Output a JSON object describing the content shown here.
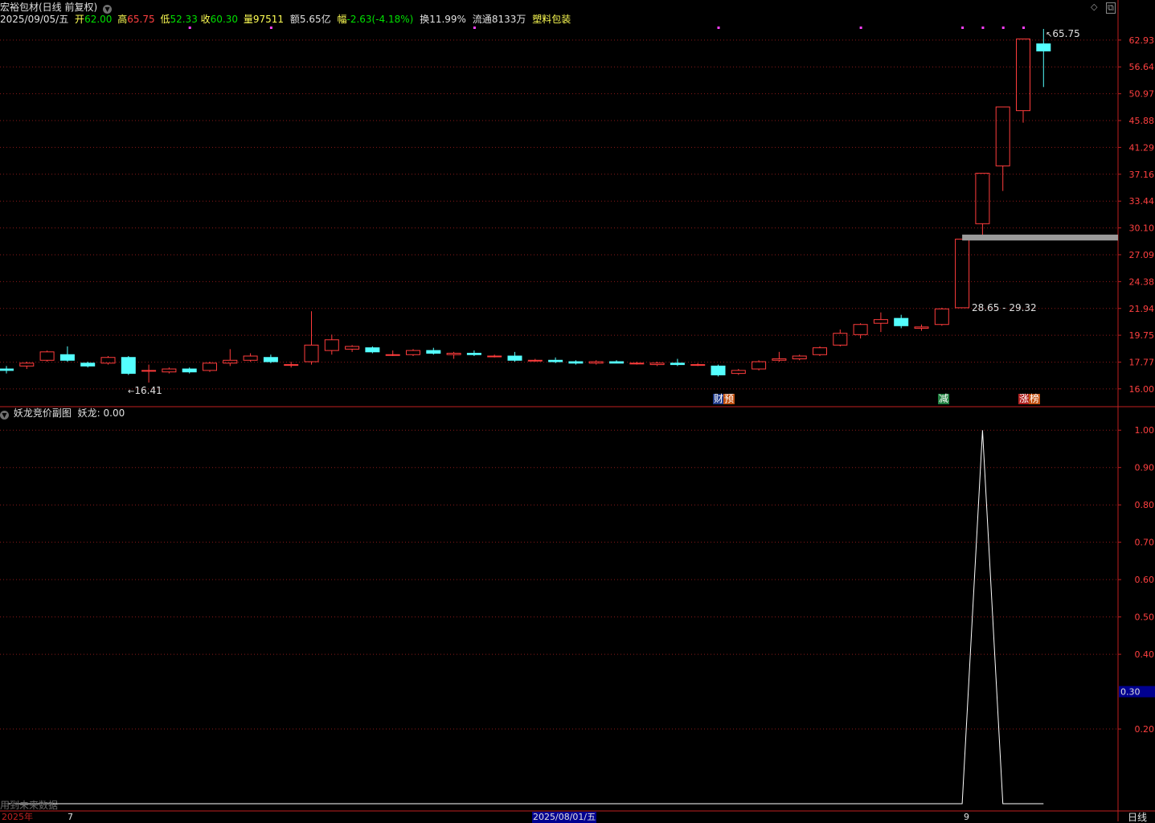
{
  "header": {
    "title": "宏裕包材(日线 前复权)",
    "row2": {
      "date": "2025/09/05/五",
      "open_label": "开",
      "open": "62.00",
      "high_label": "高",
      "high": "65.75",
      "low_label": "低",
      "low": "52.33",
      "close_label": "收",
      "close": "60.30",
      "vol_label": "量",
      "vol": "97511",
      "amt_label": "额",
      "amt": "5.65亿",
      "chg_label": "幅",
      "chg": "-2.63(-4.18%)",
      "turn_label": "换",
      "turn": "11.99%",
      "float_label": "流通",
      "float": "8133万",
      "sector": "塑料包装"
    },
    "controls": {
      "diamond": "◇",
      "restore": "⧉"
    }
  },
  "indicator": {
    "title": "妖龙竞价副图",
    "value_label": "妖龙: 0.00",
    "footnote": "用到未来数据"
  },
  "time_axis": {
    "year": "2025年",
    "m1": "7",
    "mid": "2025/08/01/五",
    "m2": "9",
    "period": "日线"
  },
  "annotations": {
    "high_label": "65.75",
    "low_label": "16.41",
    "gap_label": "28.65 - 29.32",
    "events": [
      "财",
      "预",
      "减",
      "涨",
      "榜"
    ]
  },
  "chart_data": [
    {
      "type": "candlestick",
      "ylim": [
        15.3,
        67.0
      ],
      "log_scale": true,
      "y_ticks": [
        16.0,
        17.77,
        19.75,
        21.94,
        24.38,
        27.09,
        30.1,
        33.44,
        37.16,
        41.29,
        45.88,
        50.97,
        56.64,
        62.93
      ],
      "grid": true,
      "candles": [
        {
          "o": 17.3,
          "h": 17.5,
          "l": 17.0,
          "c": 17.2
        },
        {
          "o": 17.5,
          "h": 17.8,
          "l": 17.3,
          "c": 17.7
        },
        {
          "o": 17.9,
          "h": 18.6,
          "l": 17.8,
          "c": 18.5
        },
        {
          "o": 18.3,
          "h": 18.9,
          "l": 17.8,
          "c": 17.9
        },
        {
          "o": 17.7,
          "h": 17.8,
          "l": 17.4,
          "c": 17.5
        },
        {
          "o": 17.7,
          "h": 18.2,
          "l": 17.6,
          "c": 18.1
        },
        {
          "o": 18.1,
          "h": 18.2,
          "l": 16.9,
          "c": 17.0
        },
        {
          "o": 17.2,
          "h": 17.6,
          "l": 16.4,
          "c": 17.2
        },
        {
          "o": 17.1,
          "h": 17.4,
          "l": 17.0,
          "c": 17.3
        },
        {
          "o": 17.3,
          "h": 17.4,
          "l": 17.0,
          "c": 17.1
        },
        {
          "o": 17.2,
          "h": 17.8,
          "l": 17.1,
          "c": 17.7
        },
        {
          "o": 17.7,
          "h": 18.7,
          "l": 17.5,
          "c": 17.9
        },
        {
          "o": 17.9,
          "h": 18.4,
          "l": 17.8,
          "c": 18.2
        },
        {
          "o": 18.1,
          "h": 18.3,
          "l": 17.7,
          "c": 17.8
        },
        {
          "o": 17.6,
          "h": 17.8,
          "l": 17.4,
          "c": 17.6
        },
        {
          "o": 17.8,
          "h": 21.7,
          "l": 17.6,
          "c": 19.0
        },
        {
          "o": 18.6,
          "h": 19.8,
          "l": 18.3,
          "c": 19.4
        },
        {
          "o": 18.7,
          "h": 19.0,
          "l": 18.5,
          "c": 18.9
        },
        {
          "o": 18.8,
          "h": 18.9,
          "l": 18.4,
          "c": 18.5
        },
        {
          "o": 18.3,
          "h": 18.6,
          "l": 18.2,
          "c": 18.3
        },
        {
          "o": 18.3,
          "h": 18.7,
          "l": 18.2,
          "c": 18.6
        },
        {
          "o": 18.6,
          "h": 18.8,
          "l": 18.3,
          "c": 18.4
        },
        {
          "o": 18.3,
          "h": 18.5,
          "l": 18.0,
          "c": 18.4
        },
        {
          "o": 18.4,
          "h": 18.6,
          "l": 18.2,
          "c": 18.3
        },
        {
          "o": 18.2,
          "h": 18.3,
          "l": 18.1,
          "c": 18.2
        },
        {
          "o": 18.2,
          "h": 18.5,
          "l": 17.8,
          "c": 17.9
        },
        {
          "o": 17.9,
          "h": 18.0,
          "l": 17.8,
          "c": 17.9
        },
        {
          "o": 17.9,
          "h": 18.1,
          "l": 17.7,
          "c": 17.8
        },
        {
          "o": 17.8,
          "h": 17.9,
          "l": 17.6,
          "c": 17.7
        },
        {
          "o": 17.7,
          "h": 17.9,
          "l": 17.6,
          "c": 17.8
        },
        {
          "o": 17.8,
          "h": 17.9,
          "l": 17.7,
          "c": 17.7
        },
        {
          "o": 17.7,
          "h": 17.8,
          "l": 17.6,
          "c": 17.7
        },
        {
          "o": 17.6,
          "h": 17.8,
          "l": 17.5,
          "c": 17.7
        },
        {
          "o": 17.7,
          "h": 18.0,
          "l": 17.5,
          "c": 17.6
        },
        {
          "o": 17.6,
          "h": 17.7,
          "l": 17.5,
          "c": 17.6
        },
        {
          "o": 17.5,
          "h": 17.6,
          "l": 16.8,
          "c": 16.9
        },
        {
          "o": 17.0,
          "h": 17.3,
          "l": 16.9,
          "c": 17.2
        },
        {
          "o": 17.3,
          "h": 17.9,
          "l": 17.2,
          "c": 17.8
        },
        {
          "o": 17.9,
          "h": 18.5,
          "l": 17.8,
          "c": 18.0
        },
        {
          "o": 18.0,
          "h": 18.3,
          "l": 17.9,
          "c": 18.2
        },
        {
          "o": 18.3,
          "h": 18.9,
          "l": 18.2,
          "c": 18.8
        },
        {
          "o": 19.0,
          "h": 20.2,
          "l": 18.9,
          "c": 19.9
        },
        {
          "o": 19.8,
          "h": 20.7,
          "l": 19.5,
          "c": 20.6
        },
        {
          "o": 20.7,
          "h": 21.6,
          "l": 20.0,
          "c": 21.0
        },
        {
          "o": 21.1,
          "h": 21.4,
          "l": 20.3,
          "c": 20.5
        },
        {
          "o": 20.3,
          "h": 20.6,
          "l": 20.1,
          "c": 20.4
        },
        {
          "o": 20.6,
          "h": 22.0,
          "l": 20.5,
          "c": 21.9
        },
        {
          "o": 22.0,
          "h": 28.8,
          "l": 22.0,
          "c": 28.8
        },
        {
          "o": 30.6,
          "h": 37.3,
          "l": 29.2,
          "c": 37.3
        },
        {
          "o": 38.4,
          "h": 48.4,
          "l": 34.8,
          "c": 48.4
        },
        {
          "o": 47.7,
          "h": 63.2,
          "l": 45.5,
          "c": 63.2
        },
        {
          "o": 62.0,
          "h": 65.75,
          "l": 52.33,
          "c": 60.3
        }
      ]
    },
    {
      "type": "line",
      "series": [
        {
          "values": [
            0,
            0,
            0,
            0,
            0,
            0,
            0,
            0,
            0,
            0,
            0,
            0,
            0,
            0,
            0,
            0,
            0,
            0,
            0,
            0,
            0,
            0,
            0,
            0,
            0,
            0,
            0,
            0,
            0,
            0,
            0,
            0,
            0,
            0,
            0,
            0,
            0,
            0,
            0,
            0,
            0,
            0,
            0,
            0,
            0,
            0,
            0,
            0,
            1,
            0,
            0,
            0
          ]
        }
      ],
      "ylim": [
        0.0,
        1.05
      ],
      "y_ticks": [
        0.2,
        0.3,
        0.4,
        0.5,
        0.6,
        0.7,
        0.8,
        0.9,
        1.0
      ],
      "cursor_value": "0.30",
      "grid": true
    }
  ],
  "colors": {
    "up": "#ff3c3c",
    "down": "#54ffff",
    "grid": "#8b1a1a",
    "axis": "#c02020",
    "bg": "#000000",
    "text": "#c8c8c8",
    "yellow": "#ffff54",
    "magenta": "#ff40ff",
    "green": "#00e000",
    "red": "#ff4040",
    "navy": "#000090"
  }
}
